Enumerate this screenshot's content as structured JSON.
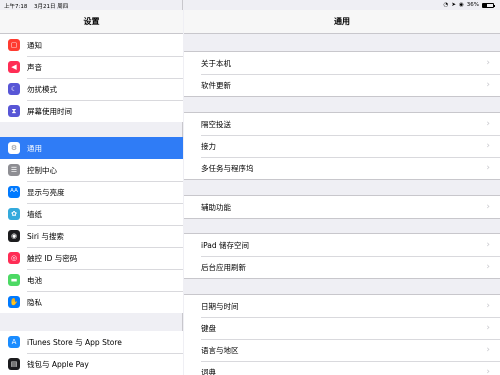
{
  "status_bar": {
    "time": "上午7:18",
    "date": "3月21日 周四",
    "battery": "36%",
    "battery_level": 0.36
  },
  "sidebar": {
    "title": "设置",
    "group1": [
      {
        "label": "通知",
        "icon": "notification-icon",
        "color": "#ff3b30"
      },
      {
        "label": "声音",
        "icon": "sound-icon",
        "color": "#ff2d55"
      },
      {
        "label": "勿扰模式",
        "icon": "moon-icon",
        "color": "#5856d6"
      },
      {
        "label": "屏幕使用时间",
        "icon": "hourglass-icon",
        "color": "#5856d6"
      }
    ],
    "group2": [
      {
        "label": "通用",
        "icon": "gear-icon",
        "color": "#8e8e93",
        "selected": true
      },
      {
        "label": "控制中心",
        "icon": "control-center-icon",
        "color": "#8e8e93"
      },
      {
        "label": "显示与亮度",
        "icon": "display-icon",
        "color": "#007aff"
      },
      {
        "label": "墙纸",
        "icon": "wallpaper-icon",
        "color": "#34aadc"
      },
      {
        "label": "Siri 与搜索",
        "icon": "siri-icon",
        "color": "#1c1c1e"
      },
      {
        "label": "触控 ID 与密码",
        "icon": "fingerprint-icon",
        "color": "#ff2d55"
      },
      {
        "label": "电池",
        "icon": "battery-icon",
        "color": "#4cd964"
      },
      {
        "label": "隐私",
        "icon": "hand-icon",
        "color": "#007aff"
      }
    ],
    "group3": [
      {
        "label": "iTunes Store 与 App Store",
        "icon": "app-store-icon",
        "color": "#1a8cff"
      },
      {
        "label": "钱包与 Apple Pay",
        "icon": "wallet-icon",
        "color": "#1c1c1e"
      }
    ]
  },
  "main": {
    "title": "通用",
    "groups": [
      [
        "关于本机",
        "软件更新"
      ],
      [
        "隔空投送",
        "接力",
        "多任务与程序坞"
      ],
      [
        "辅助功能"
      ],
      [
        "iPad 储存空间",
        "后台应用刷新"
      ],
      [
        "日期与时间",
        "键盘",
        "语言与地区",
        "词典"
      ]
    ]
  }
}
